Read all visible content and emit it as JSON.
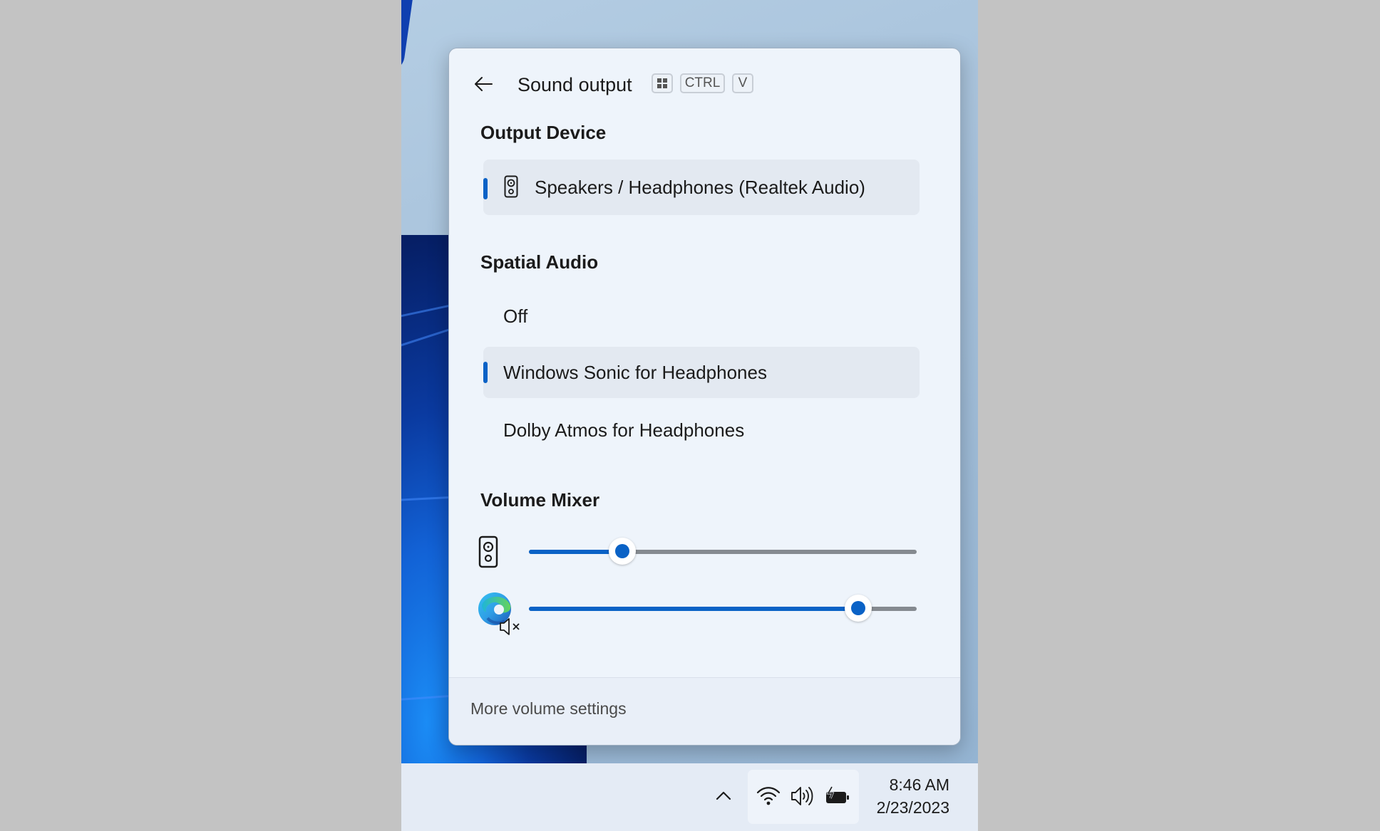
{
  "flyout": {
    "title": "Sound output",
    "shortcut_keys": [
      "win",
      "CTRL",
      "V"
    ],
    "back_icon": "arrow-left-icon"
  },
  "output_device": {
    "heading": "Output Device",
    "devices": [
      {
        "label": "Speakers / Headphones (Realtek Audio)",
        "icon": "speaker-icon",
        "selected": true
      }
    ]
  },
  "spatial_audio": {
    "heading": "Spatial Audio",
    "options": [
      {
        "label": "Off",
        "selected": false
      },
      {
        "label": "Windows Sonic for Headphones",
        "selected": true
      },
      {
        "label": "Dolby Atmos for Headphones",
        "selected": false
      }
    ]
  },
  "volume_mixer": {
    "heading": "Volume Mixer",
    "channels": [
      {
        "name": "System speakers",
        "icon": "speaker-icon",
        "level": 0.24,
        "muted": false
      },
      {
        "name": "Microsoft Edge",
        "icon": "edge-icon",
        "level": 0.85,
        "muted": true
      }
    ]
  },
  "footer": {
    "more_label": "More volume settings"
  },
  "taskbar": {
    "tray_icons": [
      "wifi-icon",
      "volume-icon",
      "battery-charging-icon"
    ],
    "time": "8:46 AM",
    "date": "2/23/2023"
  },
  "colors": {
    "accent": "#0a62c6",
    "track": "#858a90",
    "panel_bg": "#eef4fb"
  }
}
